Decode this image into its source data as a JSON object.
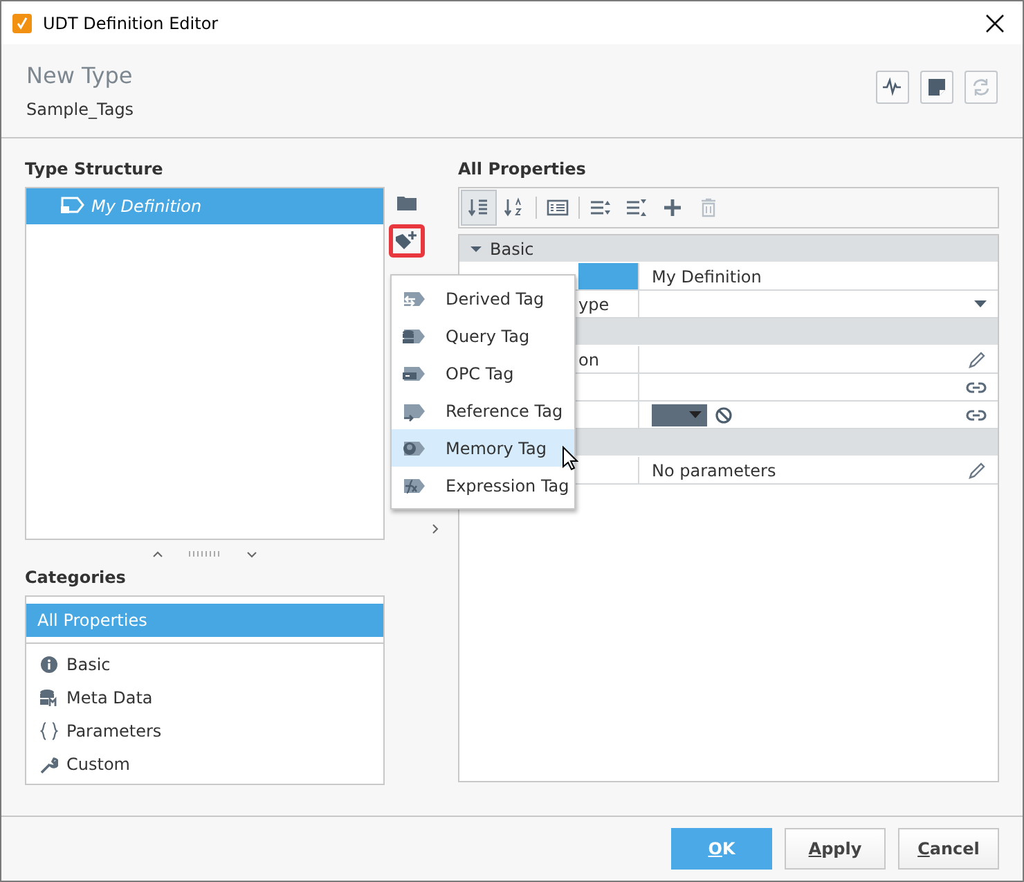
{
  "window": {
    "title": "UDT Definition Editor"
  },
  "header": {
    "title": "New Type",
    "subtitle": "Sample_Tags",
    "buttons": [
      {
        "kind": "pulse",
        "disabled": false
      },
      {
        "kind": "note",
        "disabled": false
      },
      {
        "kind": "refresh",
        "disabled": true
      }
    ]
  },
  "type_structure": {
    "heading": "Type Structure",
    "items": [
      {
        "label": "My Definition",
        "selected": true
      }
    ]
  },
  "add_tag_menu": {
    "items": [
      {
        "label": "Derived Tag",
        "kind": "derived",
        "selected": false
      },
      {
        "label": "Query Tag",
        "kind": "query",
        "selected": false
      },
      {
        "label": "OPC Tag",
        "kind": "opc",
        "selected": false
      },
      {
        "label": "Reference Tag",
        "kind": "reference",
        "selected": false
      },
      {
        "label": "Memory Tag",
        "kind": "memory",
        "selected": true
      },
      {
        "label": "Expression Tag",
        "kind": "expression",
        "selected": false
      }
    ]
  },
  "categories": {
    "heading": "Categories",
    "items": [
      {
        "label": "All Properties",
        "kind": "all",
        "selected": true
      },
      {
        "label": "Basic",
        "kind": "info",
        "selected": false
      },
      {
        "label": "Meta Data",
        "kind": "meta",
        "selected": false
      },
      {
        "label": "Parameters",
        "kind": "braces",
        "selected": false
      },
      {
        "label": "Custom",
        "kind": "wrench",
        "selected": false
      }
    ]
  },
  "properties": {
    "heading": "All Properties",
    "toolbar": [
      {
        "kind": "sort-category",
        "selected": true,
        "disabled": false
      },
      {
        "kind": "sort-alpha",
        "selected": false,
        "disabled": false
      },
      {
        "kind": "details",
        "selected": false,
        "disabled": false
      },
      {
        "kind": "expand",
        "selected": false,
        "disabled": false
      },
      {
        "kind": "collapse",
        "selected": false,
        "disabled": false
      },
      {
        "kind": "add",
        "selected": false,
        "disabled": false
      },
      {
        "kind": "delete",
        "selected": false,
        "disabled": true
      }
    ],
    "rows": [
      {
        "kind": "section",
        "label": "Basic",
        "expanded": true
      },
      {
        "kind": "property",
        "selected": true,
        "value": "My Definition"
      },
      {
        "kind": "property",
        "selected": false,
        "label": "ype",
        "editor": {
          "kind": "dropdown"
        }
      },
      {
        "kind": "section"
      },
      {
        "kind": "property",
        "selected": false,
        "label": "on",
        "editor": {
          "kind": "edit"
        }
      },
      {
        "kind": "property",
        "selected": false,
        "editor": {
          "kind": "link"
        }
      },
      {
        "kind": "property",
        "selected": false,
        "editor": {
          "kind": "color-link"
        }
      },
      {
        "kind": "section"
      },
      {
        "kind": "property",
        "selected": false,
        "value": "No parameters",
        "editor": {
          "kind": "edit"
        }
      }
    ]
  },
  "buttons": [
    {
      "label": "OK",
      "kind": "primary"
    },
    {
      "label": "Apply",
      "kind": "default"
    },
    {
      "label": "Cancel",
      "kind": "default"
    }
  ]
}
